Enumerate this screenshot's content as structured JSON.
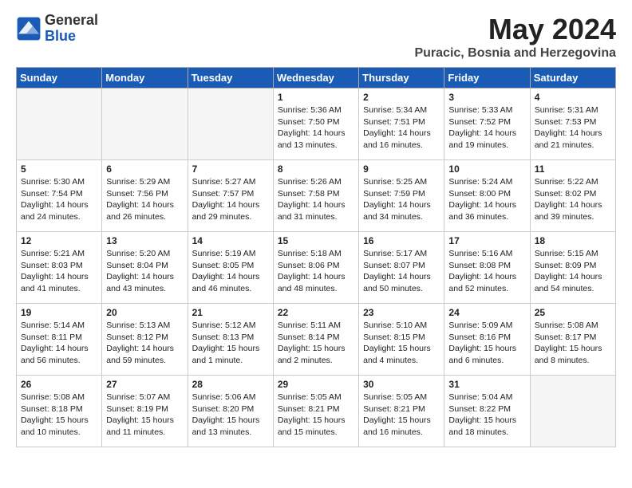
{
  "header": {
    "logo_general": "General",
    "logo_blue": "Blue",
    "month_title": "May 2024",
    "location": "Puracic, Bosnia and Herzegovina"
  },
  "weekdays": [
    "Sunday",
    "Monday",
    "Tuesday",
    "Wednesday",
    "Thursday",
    "Friday",
    "Saturday"
  ],
  "weeks": [
    [
      {
        "day": "",
        "empty": true
      },
      {
        "day": "",
        "empty": true
      },
      {
        "day": "",
        "empty": true
      },
      {
        "day": "1",
        "sunrise": "5:36 AM",
        "sunset": "7:50 PM",
        "daylight": "14 hours and 13 minutes."
      },
      {
        "day": "2",
        "sunrise": "5:34 AM",
        "sunset": "7:51 PM",
        "daylight": "14 hours and 16 minutes."
      },
      {
        "day": "3",
        "sunrise": "5:33 AM",
        "sunset": "7:52 PM",
        "daylight": "14 hours and 19 minutes."
      },
      {
        "day": "4",
        "sunrise": "5:31 AM",
        "sunset": "7:53 PM",
        "daylight": "14 hours and 21 minutes."
      }
    ],
    [
      {
        "day": "5",
        "sunrise": "5:30 AM",
        "sunset": "7:54 PM",
        "daylight": "14 hours and 24 minutes."
      },
      {
        "day": "6",
        "sunrise": "5:29 AM",
        "sunset": "7:56 PM",
        "daylight": "14 hours and 26 minutes."
      },
      {
        "day": "7",
        "sunrise": "5:27 AM",
        "sunset": "7:57 PM",
        "daylight": "14 hours and 29 minutes."
      },
      {
        "day": "8",
        "sunrise": "5:26 AM",
        "sunset": "7:58 PM",
        "daylight": "14 hours and 31 minutes."
      },
      {
        "day": "9",
        "sunrise": "5:25 AM",
        "sunset": "7:59 PM",
        "daylight": "14 hours and 34 minutes."
      },
      {
        "day": "10",
        "sunrise": "5:24 AM",
        "sunset": "8:00 PM",
        "daylight": "14 hours and 36 minutes."
      },
      {
        "day": "11",
        "sunrise": "5:22 AM",
        "sunset": "8:02 PM",
        "daylight": "14 hours and 39 minutes."
      }
    ],
    [
      {
        "day": "12",
        "sunrise": "5:21 AM",
        "sunset": "8:03 PM",
        "daylight": "14 hours and 41 minutes."
      },
      {
        "day": "13",
        "sunrise": "5:20 AM",
        "sunset": "8:04 PM",
        "daylight": "14 hours and 43 minutes."
      },
      {
        "day": "14",
        "sunrise": "5:19 AM",
        "sunset": "8:05 PM",
        "daylight": "14 hours and 46 minutes."
      },
      {
        "day": "15",
        "sunrise": "5:18 AM",
        "sunset": "8:06 PM",
        "daylight": "14 hours and 48 minutes."
      },
      {
        "day": "16",
        "sunrise": "5:17 AM",
        "sunset": "8:07 PM",
        "daylight": "14 hours and 50 minutes."
      },
      {
        "day": "17",
        "sunrise": "5:16 AM",
        "sunset": "8:08 PM",
        "daylight": "14 hours and 52 minutes."
      },
      {
        "day": "18",
        "sunrise": "5:15 AM",
        "sunset": "8:09 PM",
        "daylight": "14 hours and 54 minutes."
      }
    ],
    [
      {
        "day": "19",
        "sunrise": "5:14 AM",
        "sunset": "8:11 PM",
        "daylight": "14 hours and 56 minutes."
      },
      {
        "day": "20",
        "sunrise": "5:13 AM",
        "sunset": "8:12 PM",
        "daylight": "14 hours and 59 minutes."
      },
      {
        "day": "21",
        "sunrise": "5:12 AM",
        "sunset": "8:13 PM",
        "daylight": "15 hours and 1 minute."
      },
      {
        "day": "22",
        "sunrise": "5:11 AM",
        "sunset": "8:14 PM",
        "daylight": "15 hours and 2 minutes."
      },
      {
        "day": "23",
        "sunrise": "5:10 AM",
        "sunset": "8:15 PM",
        "daylight": "15 hours and 4 minutes."
      },
      {
        "day": "24",
        "sunrise": "5:09 AM",
        "sunset": "8:16 PM",
        "daylight": "15 hours and 6 minutes."
      },
      {
        "day": "25",
        "sunrise": "5:08 AM",
        "sunset": "8:17 PM",
        "daylight": "15 hours and 8 minutes."
      }
    ],
    [
      {
        "day": "26",
        "sunrise": "5:08 AM",
        "sunset": "8:18 PM",
        "daylight": "15 hours and 10 minutes."
      },
      {
        "day": "27",
        "sunrise": "5:07 AM",
        "sunset": "8:19 PM",
        "daylight": "15 hours and 11 minutes."
      },
      {
        "day": "28",
        "sunrise": "5:06 AM",
        "sunset": "8:20 PM",
        "daylight": "15 hours and 13 minutes."
      },
      {
        "day": "29",
        "sunrise": "5:05 AM",
        "sunset": "8:21 PM",
        "daylight": "15 hours and 15 minutes."
      },
      {
        "day": "30",
        "sunrise": "5:05 AM",
        "sunset": "8:21 PM",
        "daylight": "15 hours and 16 minutes."
      },
      {
        "day": "31",
        "sunrise": "5:04 AM",
        "sunset": "8:22 PM",
        "daylight": "15 hours and 18 minutes."
      },
      {
        "day": "",
        "empty": true
      }
    ]
  ]
}
